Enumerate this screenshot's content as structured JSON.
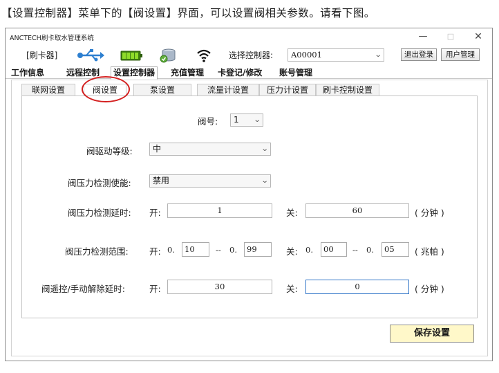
{
  "caption": "【设置控制器】菜单下的【阀设置】界面，可以设置阀相关参数。请看下图。",
  "window": {
    "title": "ANCTECH刷卡取水管理系统",
    "controls": {
      "minimize": "—",
      "maximize": "□",
      "close": "✕"
    }
  },
  "toolbar": {
    "reader_label": "[刷卡器]",
    "icons": [
      "usb-icon",
      "battery-icon",
      "database-icon",
      "wifi-icon"
    ],
    "select_label": "选择控制器:",
    "controller_value": "A00001",
    "logout_label": "退出登录",
    "user_mgmt_label": "用户管理"
  },
  "main_tabs": [
    "工作信息",
    "远程控制",
    "设置控制器",
    "充值管理",
    "卡登记/修改",
    "账号管理"
  ],
  "main_tab_active": "设置控制器",
  "sub_tabs": [
    "联网设置",
    "阀设置",
    "泵设置",
    "流量计设置",
    "压力计设置",
    "刷卡控制设置"
  ],
  "sub_tab_active": "阀设置",
  "form": {
    "valve_no_label": "阀号:",
    "valve_no_value": "1",
    "drive_level_label": "阀驱动等级:",
    "drive_level_value": "中",
    "pressure_enable_label": "阀压力检测使能:",
    "pressure_enable_value": "禁用",
    "pressure_delay_label": "阀压力检测延时:",
    "open_label": "开:",
    "close_label": "关:",
    "pressure_delay_open": "1",
    "pressure_delay_close": "60",
    "minute_unit": "( 分钟 )",
    "pressure_range_label": "阀压力检测范围:",
    "range_prefix": "0.",
    "range_sep": "--",
    "range_open_min": "10",
    "range_open_max": "99",
    "range_close_min": "00",
    "range_close_max": "05",
    "mpa_unit": "( 兆帕 )",
    "remote_delay_label": "阀遥控/手动解除延时:",
    "remote_delay_open": "30",
    "remote_delay_close": "0"
  },
  "save_label": "保存设置",
  "colors": {
    "annotation_ring": "#d42020",
    "save_button_bg": "#fff8c9",
    "focus_border": "#2f74c7"
  }
}
